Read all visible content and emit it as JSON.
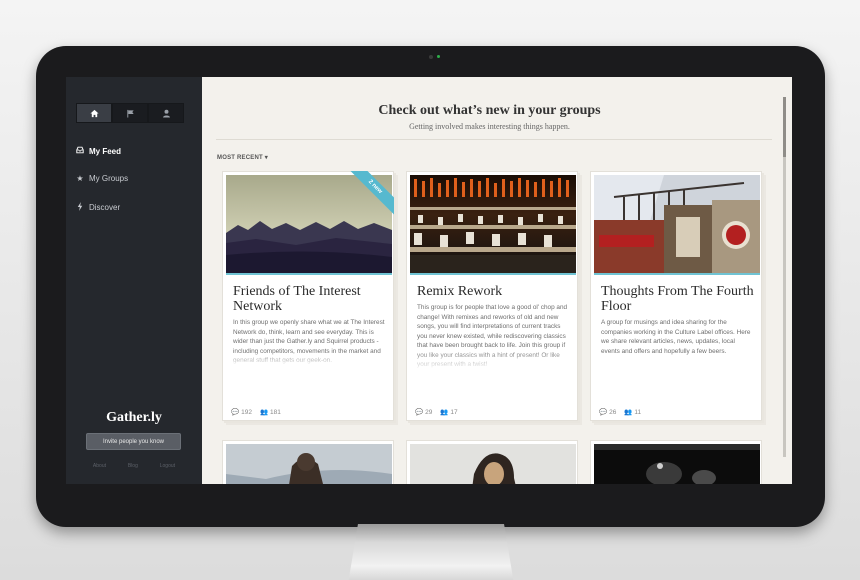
{
  "sidebar": {
    "nav_icons": [
      "home-icon",
      "flag-icon",
      "user-icon"
    ],
    "items": [
      {
        "label": "My Feed",
        "icon": "inbox-icon",
        "active": true
      },
      {
        "label": "My Groups",
        "icon": "star-icon",
        "active": false
      },
      {
        "label": "Discover",
        "icon": "bolt-icon",
        "active": false
      }
    ],
    "brand": "Gather.ly",
    "invite_label": "Invite people you know",
    "footer": [
      "About",
      "Blog",
      "Logout"
    ]
  },
  "header": {
    "title": "Check out what’s new in your groups",
    "subtitle": "Getting involved makes interesting things happen."
  },
  "sort": {
    "label": "MOST RECENT"
  },
  "cards": [
    {
      "title": "Friends of The Interest Network",
      "ribbon": "2 new",
      "description": "In this group we openly share what we at The Interest Network do, think, learn and see everyday. This is wider than just the Gather.ly and Squirrel products - including competitors, movements in the market and general stuff that gets our geek-on.",
      "comments": "192",
      "members": "181"
    },
    {
      "title": "Remix Rework",
      "description": "This group is for people that love a good ol' chop and change! With remixes and reworks of old and new songs, you will find interpretations of current tracks you never knew existed, while rediscovering classics that have been brought back to life. Join this group if you like your classics with a hint of present! Or like your present with a twist!",
      "comments": "29",
      "members": "17"
    },
    {
      "title": "Thoughts From The Fourth Floor",
      "description": "A group for musings and idea sharing for the companies working in the Culture Label offices. Here we share relevant articles, news, updates, local events and offers and hopefully a few beers.",
      "comments": "26",
      "members": "11"
    }
  ],
  "colors": {
    "sidebar_bg": "#25282d",
    "content_bg": "#f3f1ec",
    "accent": "#56b9cf"
  }
}
